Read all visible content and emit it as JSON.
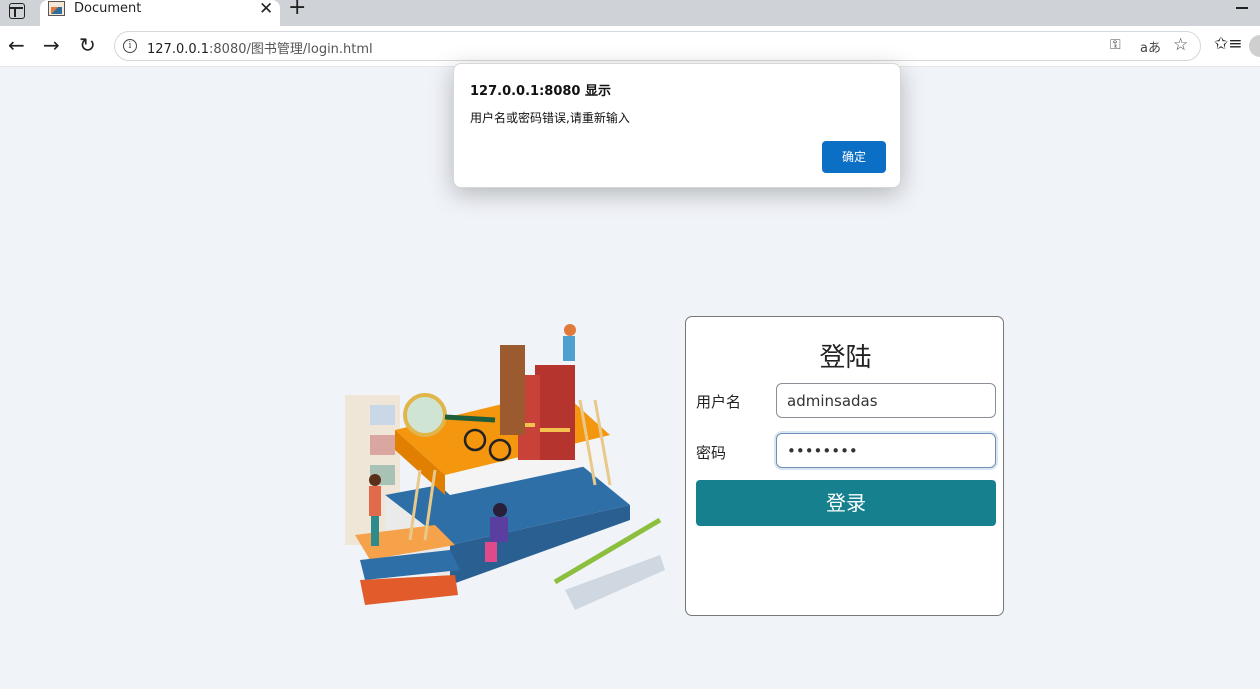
{
  "browser": {
    "tab_title": "Document",
    "tab_close": "✕",
    "new_tab": "+",
    "url_host": "127.0.0.1",
    "url_rest": ":8080/图书管理/login.html",
    "back": "←",
    "forward": "→",
    "reload": "↻",
    "info": "i",
    "key_icon": "⚿",
    "read_aloud": "aあ",
    "star": "☆",
    "favorites": "✩≡"
  },
  "alert": {
    "title": "127.0.0.1:8080 显示",
    "message": "用户名或密码错误,请重新输入",
    "ok_label": "确定"
  },
  "login": {
    "title": "登陆",
    "username_label": "用户名",
    "username_value": "adminsadas",
    "password_label": "密码",
    "password_value": "••••••••",
    "submit_label": "登录"
  },
  "colors": {
    "accent": "#16808f",
    "dialog_button": "#0b6fc6",
    "page_background": "#f0f3f8"
  }
}
